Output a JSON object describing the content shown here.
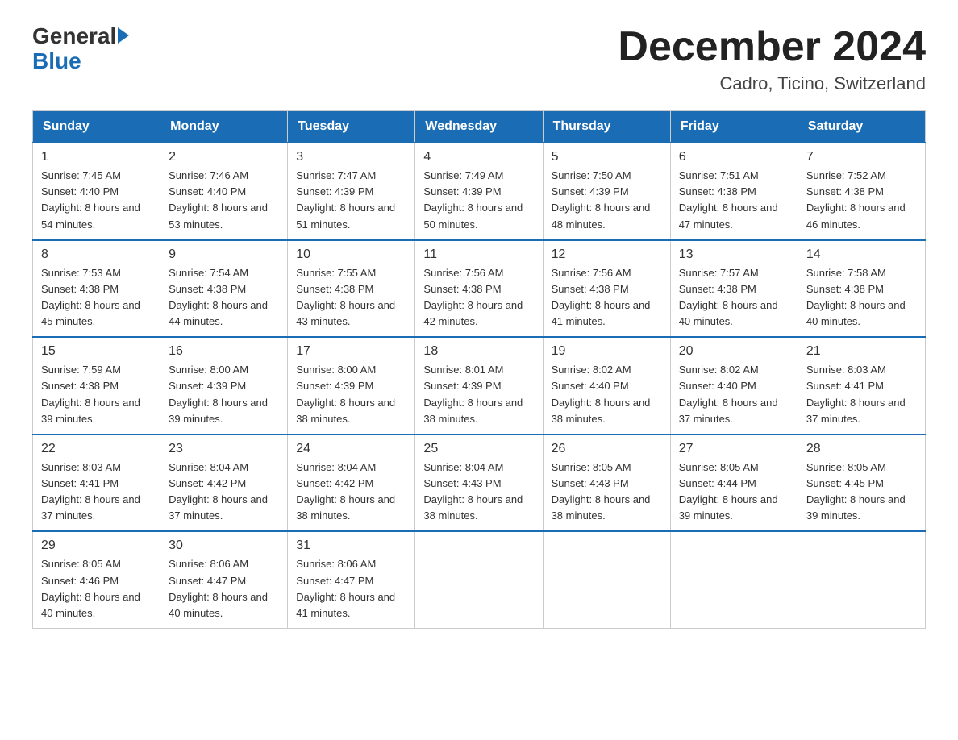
{
  "header": {
    "logo_general": "General",
    "logo_blue": "Blue",
    "month_title": "December 2024",
    "location": "Cadro, Ticino, Switzerland"
  },
  "days_of_week": [
    "Sunday",
    "Monday",
    "Tuesday",
    "Wednesday",
    "Thursday",
    "Friday",
    "Saturday"
  ],
  "weeks": [
    [
      {
        "day": "1",
        "sunrise": "7:45 AM",
        "sunset": "4:40 PM",
        "daylight": "8 hours and 54 minutes."
      },
      {
        "day": "2",
        "sunrise": "7:46 AM",
        "sunset": "4:40 PM",
        "daylight": "8 hours and 53 minutes."
      },
      {
        "day": "3",
        "sunrise": "7:47 AM",
        "sunset": "4:39 PM",
        "daylight": "8 hours and 51 minutes."
      },
      {
        "day": "4",
        "sunrise": "7:49 AM",
        "sunset": "4:39 PM",
        "daylight": "8 hours and 50 minutes."
      },
      {
        "day": "5",
        "sunrise": "7:50 AM",
        "sunset": "4:39 PM",
        "daylight": "8 hours and 48 minutes."
      },
      {
        "day": "6",
        "sunrise": "7:51 AM",
        "sunset": "4:38 PM",
        "daylight": "8 hours and 47 minutes."
      },
      {
        "day": "7",
        "sunrise": "7:52 AM",
        "sunset": "4:38 PM",
        "daylight": "8 hours and 46 minutes."
      }
    ],
    [
      {
        "day": "8",
        "sunrise": "7:53 AM",
        "sunset": "4:38 PM",
        "daylight": "8 hours and 45 minutes."
      },
      {
        "day": "9",
        "sunrise": "7:54 AM",
        "sunset": "4:38 PM",
        "daylight": "8 hours and 44 minutes."
      },
      {
        "day": "10",
        "sunrise": "7:55 AM",
        "sunset": "4:38 PM",
        "daylight": "8 hours and 43 minutes."
      },
      {
        "day": "11",
        "sunrise": "7:56 AM",
        "sunset": "4:38 PM",
        "daylight": "8 hours and 42 minutes."
      },
      {
        "day": "12",
        "sunrise": "7:56 AM",
        "sunset": "4:38 PM",
        "daylight": "8 hours and 41 minutes."
      },
      {
        "day": "13",
        "sunrise": "7:57 AM",
        "sunset": "4:38 PM",
        "daylight": "8 hours and 40 minutes."
      },
      {
        "day": "14",
        "sunrise": "7:58 AM",
        "sunset": "4:38 PM",
        "daylight": "8 hours and 40 minutes."
      }
    ],
    [
      {
        "day": "15",
        "sunrise": "7:59 AM",
        "sunset": "4:38 PM",
        "daylight": "8 hours and 39 minutes."
      },
      {
        "day": "16",
        "sunrise": "8:00 AM",
        "sunset": "4:39 PM",
        "daylight": "8 hours and 39 minutes."
      },
      {
        "day": "17",
        "sunrise": "8:00 AM",
        "sunset": "4:39 PM",
        "daylight": "8 hours and 38 minutes."
      },
      {
        "day": "18",
        "sunrise": "8:01 AM",
        "sunset": "4:39 PM",
        "daylight": "8 hours and 38 minutes."
      },
      {
        "day": "19",
        "sunrise": "8:02 AM",
        "sunset": "4:40 PM",
        "daylight": "8 hours and 38 minutes."
      },
      {
        "day": "20",
        "sunrise": "8:02 AM",
        "sunset": "4:40 PM",
        "daylight": "8 hours and 37 minutes."
      },
      {
        "day": "21",
        "sunrise": "8:03 AM",
        "sunset": "4:41 PM",
        "daylight": "8 hours and 37 minutes."
      }
    ],
    [
      {
        "day": "22",
        "sunrise": "8:03 AM",
        "sunset": "4:41 PM",
        "daylight": "8 hours and 37 minutes."
      },
      {
        "day": "23",
        "sunrise": "8:04 AM",
        "sunset": "4:42 PM",
        "daylight": "8 hours and 37 minutes."
      },
      {
        "day": "24",
        "sunrise": "8:04 AM",
        "sunset": "4:42 PM",
        "daylight": "8 hours and 38 minutes."
      },
      {
        "day": "25",
        "sunrise": "8:04 AM",
        "sunset": "4:43 PM",
        "daylight": "8 hours and 38 minutes."
      },
      {
        "day": "26",
        "sunrise": "8:05 AM",
        "sunset": "4:43 PM",
        "daylight": "8 hours and 38 minutes."
      },
      {
        "day": "27",
        "sunrise": "8:05 AM",
        "sunset": "4:44 PM",
        "daylight": "8 hours and 39 minutes."
      },
      {
        "day": "28",
        "sunrise": "8:05 AM",
        "sunset": "4:45 PM",
        "daylight": "8 hours and 39 minutes."
      }
    ],
    [
      {
        "day": "29",
        "sunrise": "8:05 AM",
        "sunset": "4:46 PM",
        "daylight": "8 hours and 40 minutes."
      },
      {
        "day": "30",
        "sunrise": "8:06 AM",
        "sunset": "4:47 PM",
        "daylight": "8 hours and 40 minutes."
      },
      {
        "day": "31",
        "sunrise": "8:06 AM",
        "sunset": "4:47 PM",
        "daylight": "8 hours and 41 minutes."
      },
      null,
      null,
      null,
      null
    ]
  ]
}
